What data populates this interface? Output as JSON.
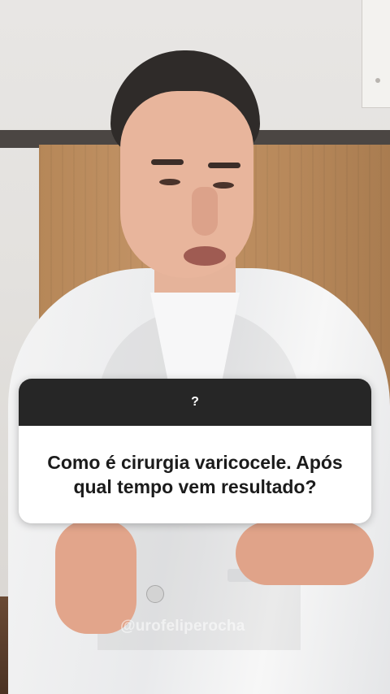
{
  "question_box": {
    "header": "?",
    "question": "Como é cirurgia varicocele. Após\nqual tempo  vem resultado?"
  },
  "watermark": {
    "handle": "@urofeliperocha"
  },
  "colors": {
    "sticker_header": "#262626",
    "sticker_body": "#ffffff"
  }
}
